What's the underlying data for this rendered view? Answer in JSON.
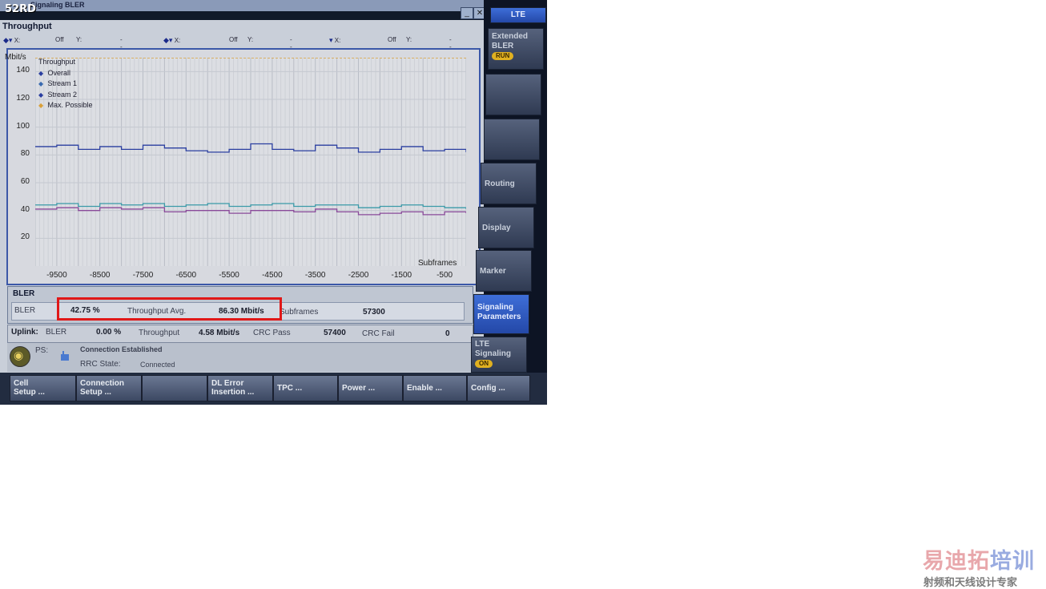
{
  "watermark": "52RD",
  "window": {
    "title": "Signaling  BLER"
  },
  "graph": {
    "title": "Throughput",
    "cursors": [
      {
        "x_label": "X:",
        "x_val": "Off",
        "y_label": "Y:",
        "y_val": "---"
      },
      {
        "x_label": "X:",
        "x_val": "Off",
        "y_label": "Y:",
        "y_val": "---"
      },
      {
        "x_label": "X:",
        "x_val": "Off",
        "y_label": "Y:",
        "y_val": "---"
      }
    ],
    "y_unit": "Mbit/s",
    "x_unit": "Subframes",
    "legend_title": "Throughput",
    "legend": [
      "Overall",
      "Stream 1",
      "Stream 2",
      "Max. Possible"
    ]
  },
  "chart_data": {
    "type": "line",
    "xlabel": "Subframes",
    "ylabel": "Mbit/s",
    "xlim": [
      -10000,
      0
    ],
    "ylim": [
      0,
      150
    ],
    "x_ticks": [
      -9500,
      -8500,
      -7500,
      -6500,
      -5500,
      -4500,
      -3500,
      -2500,
      -1500,
      -500
    ],
    "y_ticks": [
      20,
      40,
      60,
      80,
      100,
      120,
      140
    ],
    "x": [
      -10000,
      -9500,
      -9000,
      -8500,
      -8000,
      -7500,
      -7000,
      -6500,
      -6000,
      -5500,
      -5000,
      -4500,
      -4000,
      -3500,
      -3000,
      -2500,
      -2000,
      -1500,
      -1000,
      -500,
      0
    ],
    "series": [
      {
        "name": "Overall",
        "color": "#2a3ea0",
        "values": [
          86,
          87,
          84,
          86,
          84,
          87,
          85,
          83,
          82,
          84,
          88,
          84,
          83,
          87,
          85,
          82,
          84,
          86,
          83,
          84,
          82
        ]
      },
      {
        "name": "Stream 1",
        "color": "#3a9aa8",
        "values": [
          44,
          45,
          43,
          45,
          44,
          45,
          43,
          44,
          45,
          43,
          44,
          45,
          43,
          44,
          44,
          42,
          43,
          44,
          43,
          42,
          41
        ]
      },
      {
        "name": "Stream 2",
        "color": "#8a4a9a",
        "values": [
          41,
          42,
          40,
          42,
          41,
          42,
          39,
          40,
          40,
          38,
          40,
          40,
          39,
          41,
          39,
          37,
          38,
          39,
          37,
          39,
          38
        ]
      },
      {
        "name": "Max. Possible",
        "color": "#d9a03a",
        "values": [
          150,
          150,
          150,
          150,
          150,
          150,
          150,
          150,
          150,
          150,
          150,
          150,
          150,
          150,
          150,
          150,
          150,
          150,
          150,
          150,
          150
        ]
      }
    ]
  },
  "bler": {
    "title": "BLER",
    "label": "BLER",
    "value": "42.75 %",
    "tp_avg_label": "Throughput Avg.",
    "tp_avg_value": "86.30 Mbit/s",
    "subframes_label": "Subframes",
    "subframes_value": "57300"
  },
  "uplink": {
    "label": "Uplink:",
    "bler_label": "BLER",
    "bler_value": "0.00 %",
    "tp_label": "Throughput",
    "tp_value": "4.58 Mbit/s",
    "crc_pass_label": "CRC Pass",
    "crc_pass_value": "57400",
    "crc_fail_label": "CRC Fail",
    "crc_fail_value": "0"
  },
  "status": {
    "ps": "PS:",
    "connection": "Connection Established",
    "rrc_label": "RRC State:",
    "rrc_value": "Connected"
  },
  "softkeys": [
    {
      "line1": "Cell",
      "line2": "Setup ..."
    },
    {
      "line1": "Connection",
      "line2": "Setup ..."
    },
    {
      "line1": "",
      "line2": ""
    },
    {
      "line1": "DL Error",
      "line2": "Insertion ..."
    },
    {
      "line1": "TPC ...",
      "line2": ""
    },
    {
      "line1": "Power ...",
      "line2": ""
    },
    {
      "line1": "Enable ...",
      "line2": ""
    },
    {
      "line1": "Config ...",
      "line2": ""
    }
  ],
  "side": {
    "top_tab": "LTE",
    "extended": "Extended",
    "extended2": "BLER",
    "run": "RUN",
    "routing": "Routing",
    "display": "Display",
    "marker": "Marker",
    "sig_params1": "Signaling",
    "sig_params2": "Parameters",
    "lte_sig1": "LTE",
    "lte_sig2": "Signaling",
    "on": "ON"
  },
  "logo": {
    "main_a": "易迪拓",
    "main_b": "培训",
    "sub": "射频和天线设计专家"
  }
}
